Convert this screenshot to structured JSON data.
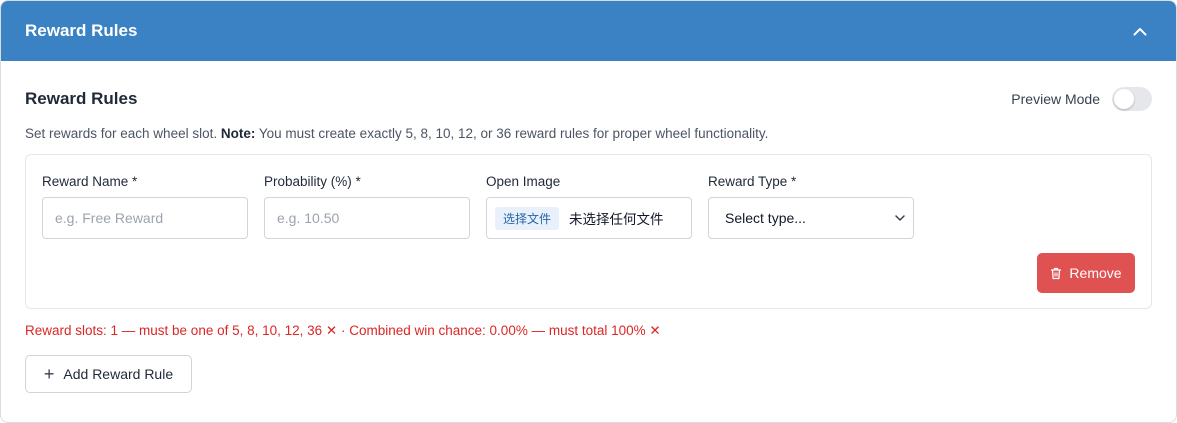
{
  "header": {
    "title": "Reward Rules",
    "collapse_icon": "chevron-up-icon"
  },
  "section": {
    "title": "Reward Rules",
    "preview_label": "Preview Mode",
    "preview_enabled": false,
    "description_prefix": "Set rewards for each wheel slot.",
    "description_note_label": "Note:",
    "description_note": "You must create exactly 5, 8, 10, 12, or 36 reward rules for proper wheel functionality."
  },
  "rule": {
    "name_label": "Reward Name *",
    "name_placeholder": "e.g. Free Reward",
    "name_value": "",
    "probability_label": "Probability (%) *",
    "probability_placeholder": "e.g. 10.50",
    "probability_value": "",
    "image_label": "Open Image",
    "file_button": "选择文件",
    "file_status": "未选择任何文件",
    "type_label": "Reward Type *",
    "type_selected": "Select type...",
    "remove_label": "Remove",
    "remove_icon": "trash-icon"
  },
  "validation": {
    "message": "Reward slots: 1 — must be one of 5, 8, 10, 12, 36 ✕ · Combined win chance: 0.00% — must total 100% ✕"
  },
  "actions": {
    "add_label": "Add Reward Rule",
    "add_icon": "plus-icon"
  },
  "colors": {
    "header_bg": "#3b82c4",
    "danger": "#e05252",
    "error_text": "#dc2626"
  }
}
